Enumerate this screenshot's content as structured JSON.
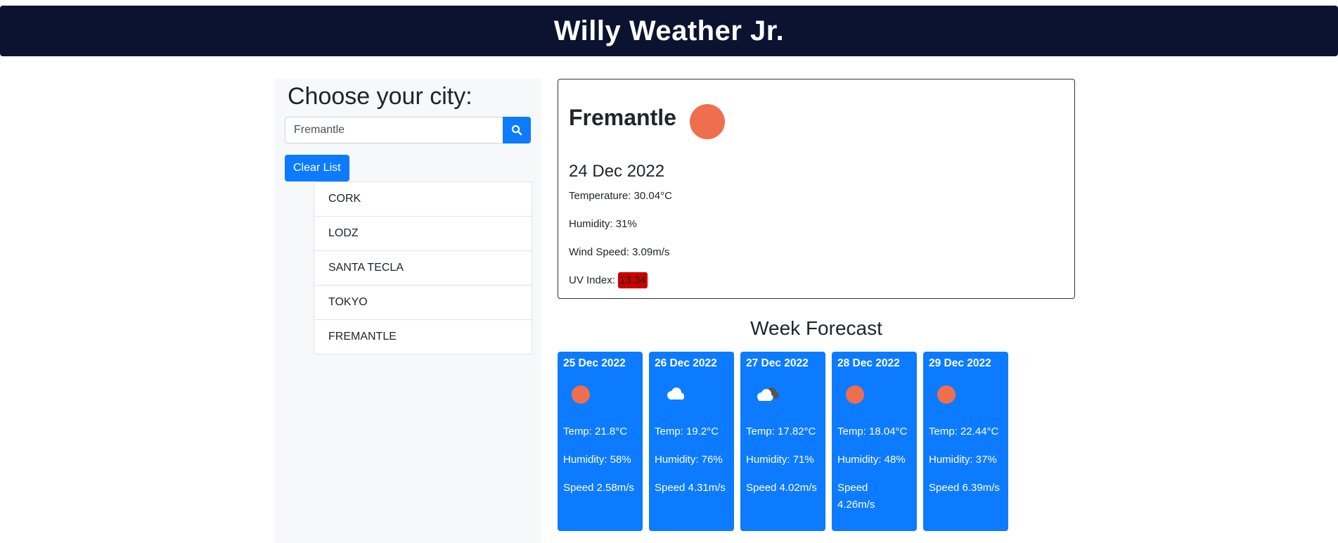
{
  "header": {
    "title": "Willy Weather Jr."
  },
  "search": {
    "heading": "Choose your city:",
    "value": "Fremantle",
    "clear_label": "Clear List",
    "history": [
      "CORK",
      "LODZ",
      "SANTA TECLA",
      "TOKYO",
      "FREMANTLE"
    ]
  },
  "current": {
    "city": "Fremantle",
    "icon": "sun-icon",
    "date": "24 Dec 2022",
    "temperature": "Temperature: 30.04°C",
    "humidity": "Humidity: 31%",
    "wind": "Wind Speed: 3.09m/s",
    "uv_label": "UV Index:",
    "uv_value": "13.34"
  },
  "forecast": {
    "title": "Week Forecast",
    "days": [
      {
        "date": "25 Dec 2022",
        "icon": "sun-icon",
        "temp": "Temp: 21.8°C",
        "humidity": "Humidity: 58%",
        "speed": "Speed 2.58m/s"
      },
      {
        "date": "26 Dec 2022",
        "icon": "cloud-icon",
        "temp": "Temp: 19.2°C",
        "humidity": "Humidity: 76%",
        "speed": "Speed 4.31m/s"
      },
      {
        "date": "27 Dec 2022",
        "icon": "broken-clouds-icon",
        "temp": "Temp: 17.82°C",
        "humidity": "Humidity: 71%",
        "speed": "Speed 4.02m/s"
      },
      {
        "date": "28 Dec 2022",
        "icon": "sun-icon",
        "temp": "Temp: 18.04°C",
        "humidity": "Humidity: 48%",
        "speed": "Speed 4.26m/s"
      },
      {
        "date": "29 Dec 2022",
        "icon": "sun-icon",
        "temp": "Temp: 22.44°C",
        "humidity": "Humidity: 37%",
        "speed": "Speed 6.39m/s"
      }
    ]
  },
  "colors": {
    "header_bg": "#0b1330",
    "accent": "#0d7bff",
    "sun": "#ee6e4e",
    "uv_high": "#cc0000"
  }
}
